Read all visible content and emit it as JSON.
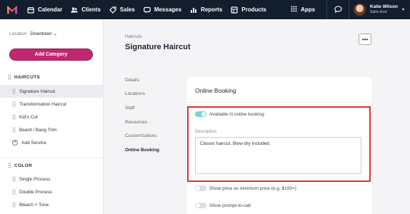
{
  "nav": {
    "items": [
      {
        "label": "Calendar",
        "icon": "calendar-icon"
      },
      {
        "label": "Clients",
        "icon": "clients-icon"
      },
      {
        "label": "Sales",
        "icon": "sales-icon"
      },
      {
        "label": "Messages",
        "icon": "messages-icon"
      },
      {
        "label": "Reports",
        "icon": "reports-icon"
      },
      {
        "label": "Products",
        "icon": "products-icon"
      }
    ],
    "apps_label": "Apps",
    "user_name": "Katie Wilson",
    "salon_name": "Salon Azul"
  },
  "sidebar": {
    "location_label": "Location",
    "location_value": "Downtown",
    "add_category_label": "Add Category",
    "categories": [
      {
        "name": "HAIRCUTS",
        "items": [
          "Signature Haircut",
          "Transformation Haircut",
          "Kid's Cut",
          "Beard / Bang Trim"
        ],
        "add_label": "Add Service"
      },
      {
        "name": "COLOR",
        "items": [
          "Single Process",
          "Double Process",
          "Bleach + Tone"
        ]
      }
    ]
  },
  "main": {
    "breadcrumb": "Haircuts",
    "title": "Signature Haircut",
    "more_label": "•••",
    "tabs": [
      "Details",
      "Locations",
      "Staff",
      "Resources",
      "Customizations",
      "Online Booking"
    ],
    "active_tab": "Online Booking"
  },
  "card": {
    "title": "Online Booking",
    "available_label": "Available in online booking",
    "description_label": "Description",
    "description_value": "Classic haircut. Blow dry included.",
    "show_price_label": "Show price as minimum price (e.g. $100+)",
    "show_prompt_label": "Show prompt-to-call"
  },
  "colors": {
    "nav_bg": "#121e2e",
    "accent": "#c2286f",
    "toggle_on": "#79d3d3",
    "highlight": "#d7332b"
  }
}
